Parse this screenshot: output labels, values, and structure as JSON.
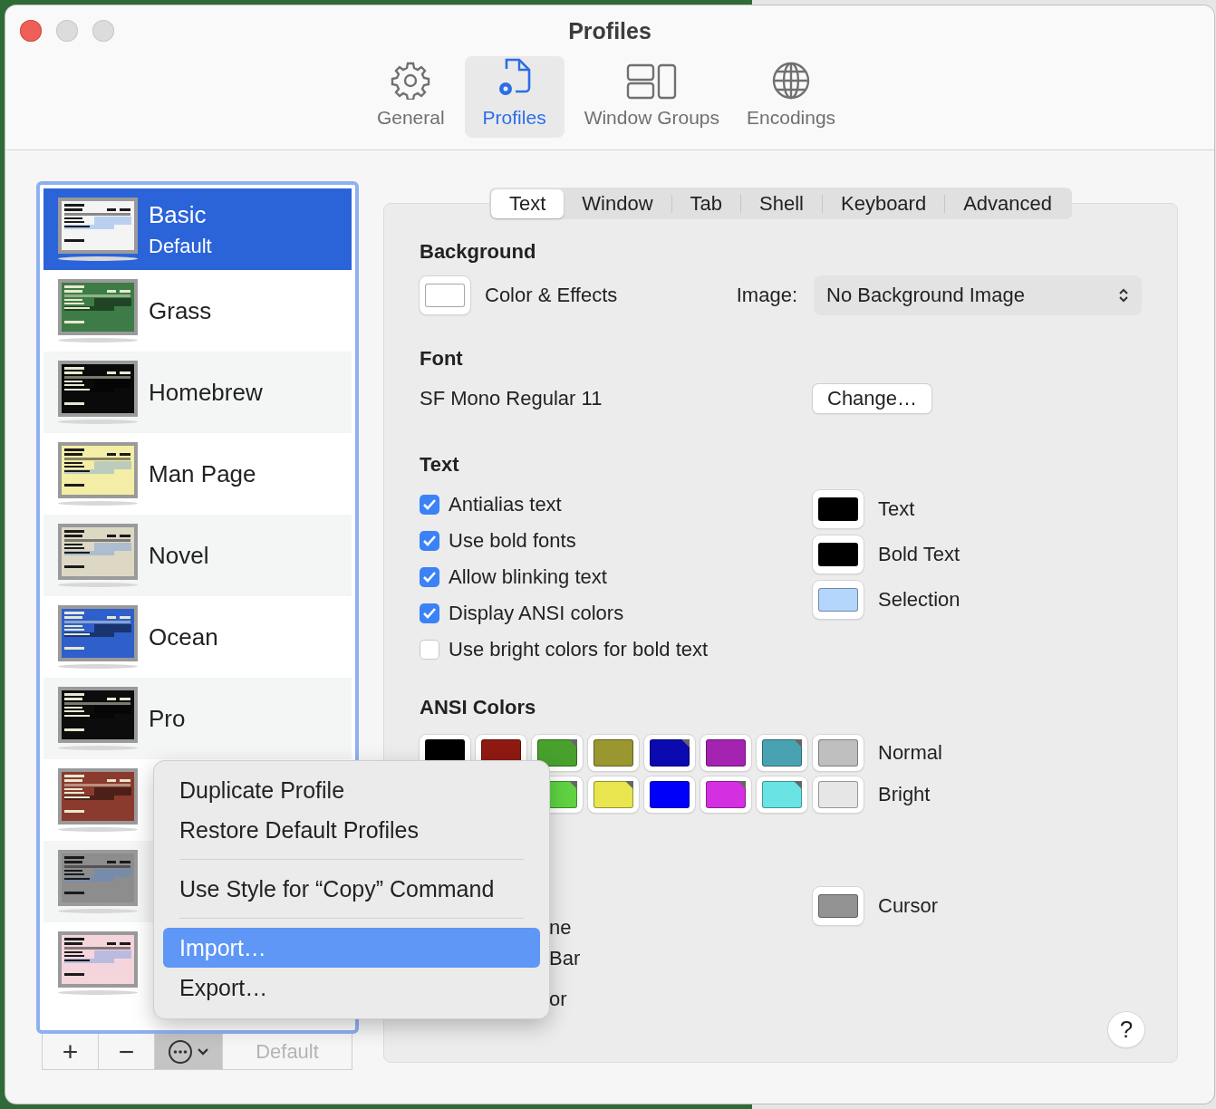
{
  "window": {
    "title": "Profiles"
  },
  "toolbar": [
    {
      "label": "General",
      "selected": false
    },
    {
      "label": "Profiles",
      "selected": true
    },
    {
      "label": "Window Groups",
      "selected": false
    },
    {
      "label": "Encodings",
      "selected": false
    }
  ],
  "profiles": [
    {
      "name": "Basic",
      "subtitle": "Default",
      "selected": true,
      "color": "#f4f4f4"
    },
    {
      "name": "Grass",
      "selected": false,
      "color": "#3d7c46"
    },
    {
      "name": "Homebrew",
      "selected": false,
      "color": "#0a0a0a"
    },
    {
      "name": "Man Page",
      "selected": false,
      "color": "#f4eda6"
    },
    {
      "name": "Novel",
      "selected": false,
      "color": "#ddd8c4"
    },
    {
      "name": "Ocean",
      "selected": false,
      "color": "#2e5fcb"
    },
    {
      "name": "Pro",
      "selected": false,
      "color": "#0c0c0c"
    },
    {
      "selected": false,
      "color": "#8b3b2e"
    },
    {
      "selected": false,
      "color": "#8d8d8d"
    },
    {
      "selected": false,
      "color": "#f5d5dc"
    }
  ],
  "list_buttons": {
    "add": "+",
    "remove": "−",
    "actions_pressed": true,
    "default": {
      "label": "Default",
      "disabled": true
    }
  },
  "tabs": [
    {
      "label": "Text",
      "selected": true
    },
    {
      "label": "Window",
      "selected": false
    },
    {
      "label": "Tab",
      "selected": false
    },
    {
      "label": "Shell",
      "selected": false
    },
    {
      "label": "Keyboard",
      "selected": false
    },
    {
      "label": "Advanced",
      "selected": false
    }
  ],
  "background": {
    "heading": "Background",
    "color": "#ffffff",
    "label": "Color & Effects",
    "image_label": "Image:",
    "image_value": "No Background Image"
  },
  "font": {
    "heading": "Font",
    "value": "SF Mono Regular 11",
    "button": "Change…"
  },
  "text": {
    "heading": "Text",
    "options": [
      {
        "label": "Antialias text",
        "checked": true
      },
      {
        "label": "Use bold fonts",
        "checked": true
      },
      {
        "label": "Allow blinking text",
        "checked": true
      },
      {
        "label": "Display ANSI colors",
        "checked": true
      },
      {
        "label": "Use bright colors for bold text",
        "checked": false
      }
    ],
    "colors": [
      {
        "label": "Text",
        "color": "#000000"
      },
      {
        "label": "Bold Text",
        "color": "#000000"
      },
      {
        "label": "Selection",
        "color": "#b4d5fc"
      }
    ]
  },
  "ansi": {
    "heading": "ANSI Colors",
    "normal": {
      "label": "Normal",
      "swatches": [
        {
          "color": "#000000",
          "flag": false
        },
        {
          "color": "#8f1a12",
          "flag": false
        },
        {
          "color": "#48a02d",
          "flag": true
        },
        {
          "color": "#9a9630",
          "flag": false
        },
        {
          "color": "#0a0ab0",
          "flag": true
        },
        {
          "color": "#a423b0",
          "flag": false
        },
        {
          "color": "#49a2b2",
          "flag": true
        },
        {
          "color": "#bfbfbf",
          "flag": false
        }
      ]
    },
    "bright": {
      "label": "Bright",
      "swatches": [
        {
          "color": "#5fd343",
          "flag": true
        },
        {
          "color": "#e8e54e",
          "flag": true
        },
        {
          "color": "#0000fa",
          "flag": false
        },
        {
          "color": "#d42fe0",
          "flag": true
        },
        {
          "color": "#69e3e3",
          "flag": true
        },
        {
          "color": "#e6e6e6",
          "flag": false
        }
      ]
    }
  },
  "cursor": {
    "label": "Cursor",
    "color": "#939393",
    "covered_texts": [
      "ne",
      "Bar",
      "or"
    ]
  },
  "help": "?",
  "menu": {
    "sections": [
      {
        "items": [
          {
            "label": "Duplicate Profile",
            "selected": false
          },
          {
            "label": "Restore Default Profiles",
            "selected": false
          }
        ]
      },
      {
        "items": [
          {
            "label": "Use Style for “Copy” Command",
            "selected": false
          }
        ]
      },
      {
        "items": [
          {
            "label": "Import…",
            "selected": true
          },
          {
            "label": "Export…",
            "selected": false
          }
        ]
      }
    ]
  }
}
